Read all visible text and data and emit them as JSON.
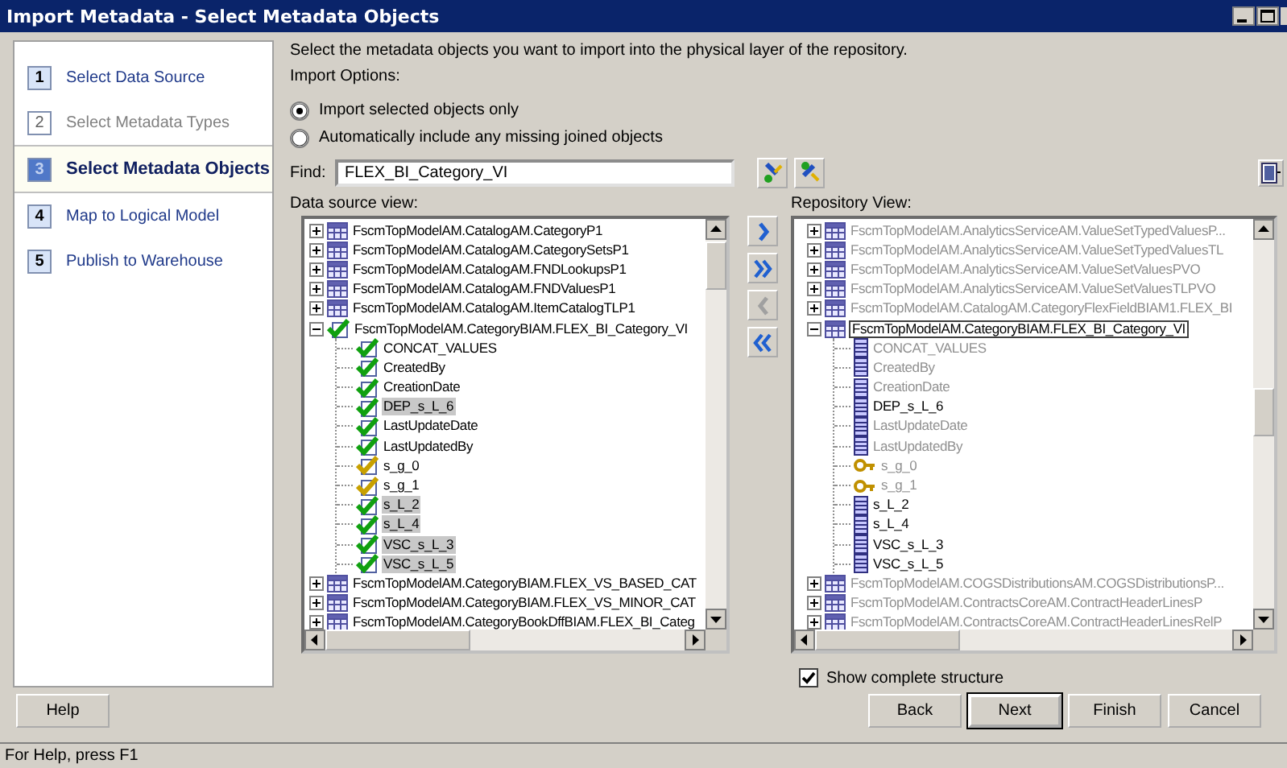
{
  "window": {
    "title": "Import Metadata - Select Metadata Objects"
  },
  "steps": [
    {
      "number": "1",
      "label": "Select Data Source",
      "selected": false,
      "disabled": false
    },
    {
      "number": "2",
      "label": "Select Metadata Types",
      "selected": false,
      "disabled": true
    },
    {
      "number": "3",
      "label": "Select Metadata Objects",
      "selected": true,
      "disabled": false
    },
    {
      "number": "4",
      "label": "Map to Logical Model",
      "selected": false,
      "disabled": false
    },
    {
      "number": "5",
      "label": "Publish to Warehouse",
      "selected": false,
      "disabled": false
    }
  ],
  "description": "Select the metadata objects you want to import into the physical layer of the repository.",
  "import_options": {
    "label": "Import Options:",
    "options": [
      {
        "label": "Import selected objects only",
        "selected": true
      },
      {
        "label": "Automatically include any missing joined objects",
        "selected": false
      }
    ]
  },
  "find": {
    "label": "Find:",
    "value": "FLEX_BI_Category_VI"
  },
  "data_source_view": {
    "label": "Data source view:",
    "tree": [
      {
        "label": "FscmTopModelAM.CatalogAM.CategoryP1",
        "kind": "table",
        "checked": false,
        "selected": false,
        "expanded": false
      },
      {
        "label": "FscmTopModelAM.CatalogAM.CategorySetsP1",
        "kind": "table",
        "checked": false,
        "selected": false,
        "expanded": false
      },
      {
        "label": "FscmTopModelAM.CatalogAM.FNDLookupsP1",
        "kind": "table",
        "checked": false,
        "selected": false,
        "expanded": false
      },
      {
        "label": "FscmTopModelAM.CatalogAM.FNDValuesP1",
        "kind": "table",
        "checked": false,
        "selected": false,
        "expanded": false
      },
      {
        "label": "FscmTopModelAM.CatalogAM.ItemCatalogTLP1",
        "kind": "table",
        "checked": false,
        "selected": false,
        "expanded": false
      },
      {
        "label": "FscmTopModelAM.CategoryBIAM.FLEX_BI_Category_VI",
        "kind": "table",
        "checked": true,
        "selected": false,
        "expanded": true,
        "children": [
          {
            "label": "CONCAT_VALUES",
            "kind": "column",
            "checked": true,
            "selected": false
          },
          {
            "label": "CreatedBy",
            "kind": "column",
            "checked": true,
            "selected": false
          },
          {
            "label": "CreationDate",
            "kind": "column",
            "checked": true,
            "selected": false
          },
          {
            "label": "DEP_s_L_6",
            "kind": "column",
            "checked": true,
            "selected": true
          },
          {
            "label": "LastUpdateDate",
            "kind": "column",
            "checked": true,
            "selected": false
          },
          {
            "label": "LastUpdatedBy",
            "kind": "column",
            "checked": true,
            "selected": false
          },
          {
            "label": "s_g_0",
            "kind": "key",
            "checked": true,
            "selected": false
          },
          {
            "label": "s_g_1",
            "kind": "key",
            "checked": true,
            "selected": false
          },
          {
            "label": "s_L_2",
            "kind": "column",
            "checked": true,
            "selected": true
          },
          {
            "label": "s_L_4",
            "kind": "column",
            "checked": true,
            "selected": true
          },
          {
            "label": "VSC_s_L_3",
            "kind": "column",
            "checked": true,
            "selected": true
          },
          {
            "label": "VSC_s_L_5",
            "kind": "column",
            "checked": true,
            "selected": true
          }
        ]
      },
      {
        "label": "FscmTopModelAM.CategoryBIAM.FLEX_VS_BASED_CAT",
        "kind": "table",
        "checked": false,
        "selected": false,
        "expanded": false
      },
      {
        "label": "FscmTopModelAM.CategoryBIAM.FLEX_VS_MINOR_CAT",
        "kind": "table",
        "checked": false,
        "selected": false,
        "expanded": false
      },
      {
        "label": "FscmTopModelAM.CategoryBookDffBIAM.FLEX_BI_Categ",
        "kind": "table",
        "checked": false,
        "selected": false,
        "expanded": false
      }
    ]
  },
  "transfer_buttons": [
    {
      "kind": "add",
      "disabled": false
    },
    {
      "kind": "add_all",
      "disabled": false
    },
    {
      "kind": "remove",
      "disabled": true
    },
    {
      "kind": "remove_all",
      "disabled": false
    }
  ],
  "repository_view": {
    "label": "Repository View:",
    "tree": [
      {
        "label": "FscmTopModelAM.AnalyticsServiceAM.ValueSetTypedValuesP...",
        "kind": "table",
        "dimmed": true,
        "selected": false,
        "expanded": false
      },
      {
        "label": "FscmTopModelAM.AnalyticsServiceAM.ValueSetTypedValuesTL",
        "kind": "table",
        "dimmed": true,
        "selected": false,
        "expanded": false
      },
      {
        "label": "FscmTopModelAM.AnalyticsServiceAM.ValueSetValuesPVO",
        "kind": "table",
        "dimmed": true,
        "selected": false,
        "expanded": false
      },
      {
        "label": "FscmTopModelAM.AnalyticsServiceAM.ValueSetValuesTLPVO",
        "kind": "table",
        "dimmed": true,
        "selected": false,
        "expanded": false
      },
      {
        "label": "FscmTopModelAM.CatalogAM.CategoryFlexFieldBIAM1.FLEX_BI",
        "kind": "table",
        "dimmed": true,
        "selected": false,
        "expanded": false
      },
      {
        "label": "FscmTopModelAM.CategoryBIAM.FLEX_BI_Category_VI",
        "kind": "table",
        "dimmed": false,
        "selected": true,
        "expanded": true,
        "children": [
          {
            "label": "CONCAT_VALUES",
            "kind": "column",
            "dimmed": true,
            "selected": false
          },
          {
            "label": "CreatedBy",
            "kind": "column",
            "dimmed": true,
            "selected": false
          },
          {
            "label": "CreationDate",
            "kind": "column",
            "dimmed": true,
            "selected": false
          },
          {
            "label": "DEP_s_L_6",
            "kind": "column",
            "dimmed": false,
            "selected": false
          },
          {
            "label": "LastUpdateDate",
            "kind": "column",
            "dimmed": true,
            "selected": false
          },
          {
            "label": "LastUpdatedBy",
            "kind": "column",
            "dimmed": true,
            "selected": false
          },
          {
            "label": "s_g_0",
            "kind": "key",
            "dimmed": true,
            "selected": false
          },
          {
            "label": "s_g_1",
            "kind": "key",
            "dimmed": true,
            "selected": false
          },
          {
            "label": "s_L_2",
            "kind": "column",
            "dimmed": false,
            "selected": false
          },
          {
            "label": "s_L_4",
            "kind": "column",
            "dimmed": false,
            "selected": false
          },
          {
            "label": "VSC_s_L_3",
            "kind": "column",
            "dimmed": false,
            "selected": false
          },
          {
            "label": "VSC_s_L_5",
            "kind": "column",
            "dimmed": false,
            "selected": false
          }
        ]
      },
      {
        "label": "FscmTopModelAM.COGSDistributionsAM.COGSDistributionsP...",
        "kind": "table",
        "dimmed": true,
        "selected": false,
        "expanded": false
      },
      {
        "label": "FscmTopModelAM.ContractsCoreAM.ContractHeaderLinesP",
        "kind": "table",
        "dimmed": true,
        "selected": false,
        "expanded": false
      },
      {
        "label": "FscmTopModelAM.ContractsCoreAM.ContractHeaderLinesRelP",
        "kind": "table",
        "dimmed": true,
        "selected": false,
        "expanded": false
      }
    ]
  },
  "show_complete_structure": {
    "label": "Show complete structure",
    "checked": true
  },
  "help_button": {
    "label": "Help"
  },
  "nav_buttons": [
    {
      "label": "Back",
      "default": false
    },
    {
      "label": "Next",
      "default": true
    },
    {
      "label": "Finish",
      "default": false
    },
    {
      "label": "Cancel",
      "default": false
    }
  ],
  "status_bar": "For Help, press F1"
}
